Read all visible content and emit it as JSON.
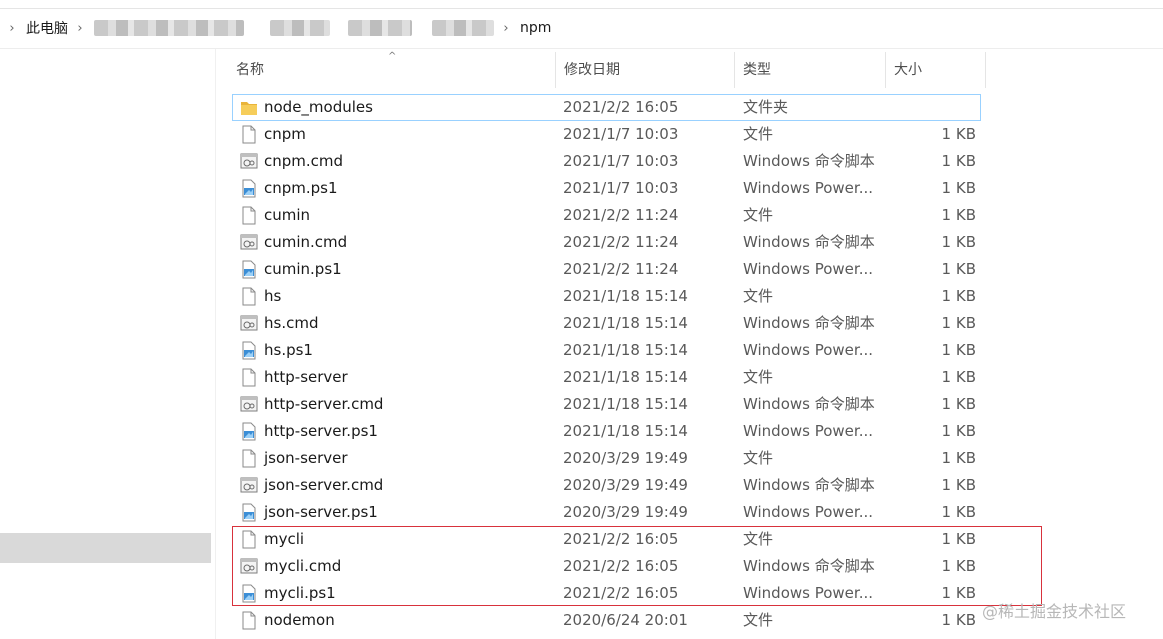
{
  "breadcrumb": {
    "items": [
      "此电脑",
      "",
      "",
      "npm"
    ]
  },
  "columns": {
    "name": "名称",
    "modified": "修改日期",
    "type": "类型",
    "size": "大小"
  },
  "files": [
    {
      "name": "node_modules",
      "date": "2021/2/2 16:05",
      "type": "文件夹",
      "size": "",
      "icon": "folder-icon"
    },
    {
      "name": "cnpm",
      "date": "2021/1/7 10:03",
      "type": "文件",
      "size": "1 KB",
      "icon": "file-icon"
    },
    {
      "name": "cnpm.cmd",
      "date": "2021/1/7 10:03",
      "type": "Windows 命令脚本",
      "size": "1 KB",
      "icon": "cmd-script-icon"
    },
    {
      "name": "cnpm.ps1",
      "date": "2021/1/7 10:03",
      "type": "Windows Power...",
      "size": "1 KB",
      "icon": "powershell-icon"
    },
    {
      "name": "cumin",
      "date": "2021/2/2 11:24",
      "type": "文件",
      "size": "1 KB",
      "icon": "file-icon"
    },
    {
      "name": "cumin.cmd",
      "date": "2021/2/2 11:24",
      "type": "Windows 命令脚本",
      "size": "1 KB",
      "icon": "cmd-script-icon"
    },
    {
      "name": "cumin.ps1",
      "date": "2021/2/2 11:24",
      "type": "Windows Power...",
      "size": "1 KB",
      "icon": "powershell-icon"
    },
    {
      "name": "hs",
      "date": "2021/1/18 15:14",
      "type": "文件",
      "size": "1 KB",
      "icon": "file-icon"
    },
    {
      "name": "hs.cmd",
      "date": "2021/1/18 15:14",
      "type": "Windows 命令脚本",
      "size": "1 KB",
      "icon": "cmd-script-icon"
    },
    {
      "name": "hs.ps1",
      "date": "2021/1/18 15:14",
      "type": "Windows Power...",
      "size": "1 KB",
      "icon": "powershell-icon"
    },
    {
      "name": "http-server",
      "date": "2021/1/18 15:14",
      "type": "文件",
      "size": "1 KB",
      "icon": "file-icon"
    },
    {
      "name": "http-server.cmd",
      "date": "2021/1/18 15:14",
      "type": "Windows 命令脚本",
      "size": "1 KB",
      "icon": "cmd-script-icon"
    },
    {
      "name": "http-server.ps1",
      "date": "2021/1/18 15:14",
      "type": "Windows Power...",
      "size": "1 KB",
      "icon": "powershell-icon"
    },
    {
      "name": "json-server",
      "date": "2020/3/29 19:49",
      "type": "文件",
      "size": "1 KB",
      "icon": "file-icon"
    },
    {
      "name": "json-server.cmd",
      "date": "2020/3/29 19:49",
      "type": "Windows 命令脚本",
      "size": "1 KB",
      "icon": "cmd-script-icon"
    },
    {
      "name": "json-server.ps1",
      "date": "2020/3/29 19:49",
      "type": "Windows Power...",
      "size": "1 KB",
      "icon": "powershell-icon"
    },
    {
      "name": "mycli",
      "date": "2021/2/2 16:05",
      "type": "文件",
      "size": "1 KB",
      "icon": "file-icon"
    },
    {
      "name": "mycli.cmd",
      "date": "2021/2/2 16:05",
      "type": "Windows 命令脚本",
      "size": "1 KB",
      "icon": "cmd-script-icon"
    },
    {
      "name": "mycli.ps1",
      "date": "2021/2/2 16:05",
      "type": "Windows Power...",
      "size": "1 KB",
      "icon": "powershell-icon"
    },
    {
      "name": "nodemon",
      "date": "2020/6/24 20:01",
      "type": "文件",
      "size": "1 KB",
      "icon": "file-icon"
    }
  ],
  "watermark": "@稀土掘金技术社区",
  "colors": {
    "highlight": "#d8323c",
    "focus": "#99d1ff",
    "folder": "#f4c043",
    "ps": "#2a7fd4"
  }
}
